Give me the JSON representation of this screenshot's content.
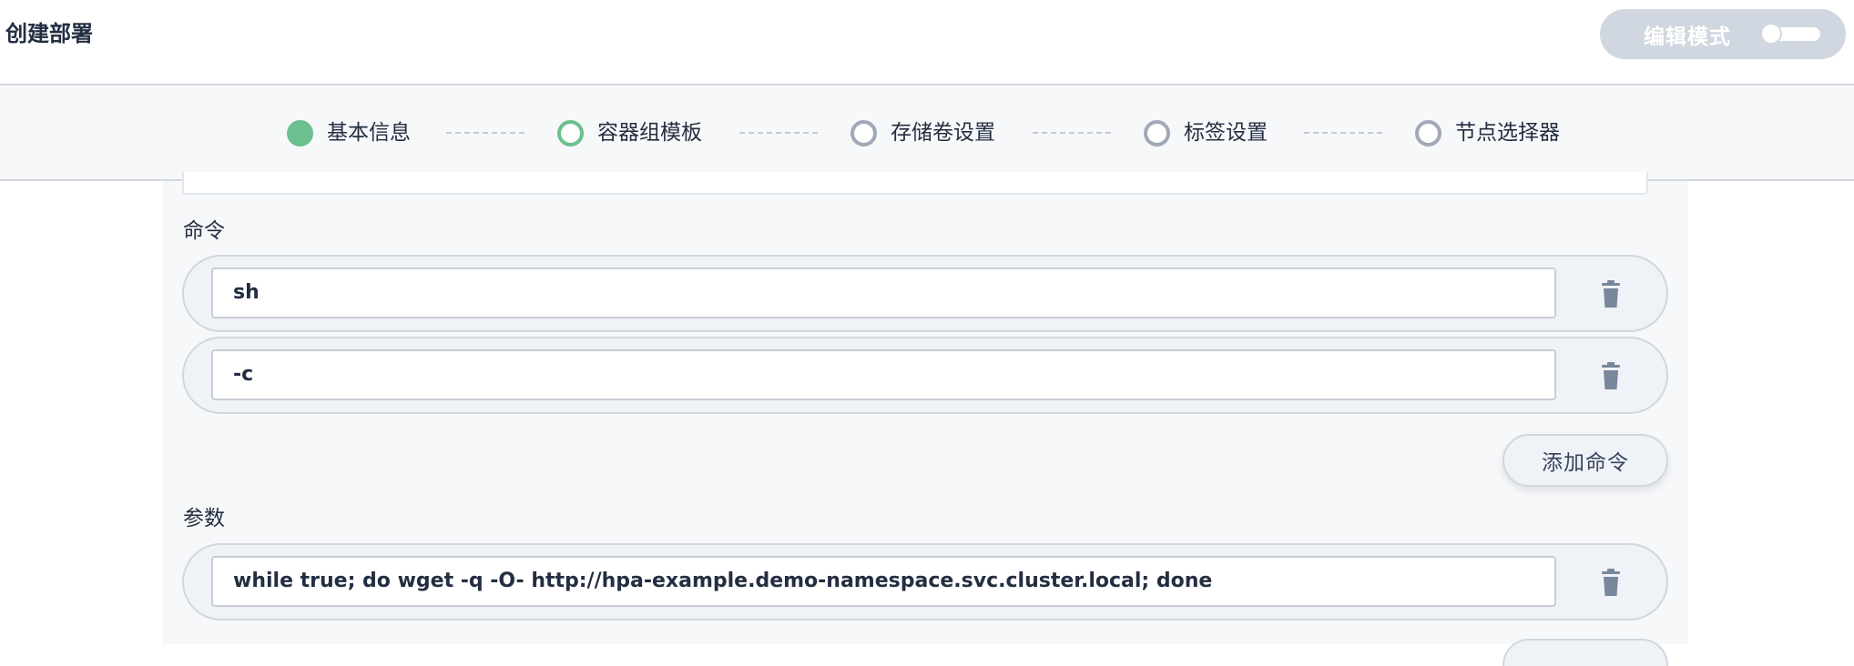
{
  "header": {
    "title": "创建部署",
    "edit_mode_label": "编辑模式",
    "edit_mode_on": false
  },
  "steps": [
    {
      "label": "基本信息",
      "state": "done"
    },
    {
      "label": "容器组模板",
      "state": "active"
    },
    {
      "label": "存储卷设置",
      "state": "pending"
    },
    {
      "label": "标签设置",
      "state": "pending"
    },
    {
      "label": "节点选择器",
      "state": "pending"
    }
  ],
  "commands": {
    "label": "命令",
    "items": [
      "sh",
      "-c"
    ],
    "add_button": "添加命令"
  },
  "args": {
    "label": "参数",
    "items": [
      "while true; do wget -q -O- http://hpa-example.demo-namespace.svc.cluster.local; done"
    ]
  },
  "colors": {
    "accent_green": "#6cbf8e",
    "border": "#d1d7e0",
    "text": "#242e42"
  }
}
